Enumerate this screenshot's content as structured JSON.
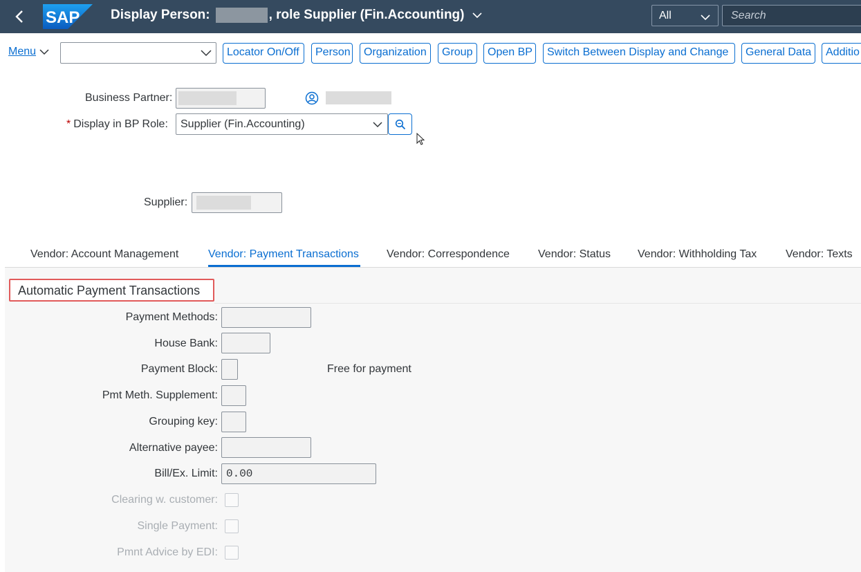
{
  "shell": {
    "logo_text": "SAP",
    "title_prefix": "Display Person:",
    "title_suffix": ", role Supplier (Fin.Accounting)",
    "scope_label": "All",
    "search_placeholder": "Search",
    "bar_color": "#354a5f"
  },
  "toolbar": {
    "menu_label": "Menu",
    "buttons": [
      {
        "label": "Locator On/Off"
      },
      {
        "label": "Person"
      },
      {
        "label": "Organization"
      },
      {
        "label": "Group"
      },
      {
        "label": "Open BP"
      },
      {
        "label": "Switch Between Display and Change"
      },
      {
        "label": "General Data"
      },
      {
        "label": "Additio"
      }
    ]
  },
  "header": {
    "business_partner_label": "Business Partner:",
    "bp_role_label": "Display in BP Role:",
    "bp_role_value": "Supplier (Fin.Accounting)",
    "supplier_label": "Supplier:",
    "required_marker": "*"
  },
  "tabs": [
    {
      "label": "Vendor: Account Management",
      "active": false
    },
    {
      "label": "Vendor: Payment Transactions",
      "active": true
    },
    {
      "label": "Vendor: Correspondence",
      "active": false
    },
    {
      "label": "Vendor: Status",
      "active": false
    },
    {
      "label": "Vendor: Withholding Tax",
      "active": false
    },
    {
      "label": "Vendor: Texts",
      "active": false
    }
  ],
  "section": {
    "title": "Automatic Payment Transactions",
    "highlight_color": "#e15a5a",
    "fields": {
      "payment_methods": "Payment Methods:",
      "house_bank": "House Bank:",
      "payment_block": "Payment Block:",
      "payment_block_text": "Free for payment",
      "pmt_meth_supplement": "Pmt Meth. Supplement:",
      "grouping_key": "Grouping key:",
      "alternative_payee": "Alternative payee:",
      "bill_ex_limit": "Bill/Ex. Limit:",
      "bill_ex_limit_value": "0.00",
      "clearing_with_customer": "Clearing w. customer:",
      "single_payment": "Single Payment:",
      "pmnt_advice_by_edi": "Pmnt Advice by EDI:"
    }
  },
  "accent_color": "#0a6ed1"
}
